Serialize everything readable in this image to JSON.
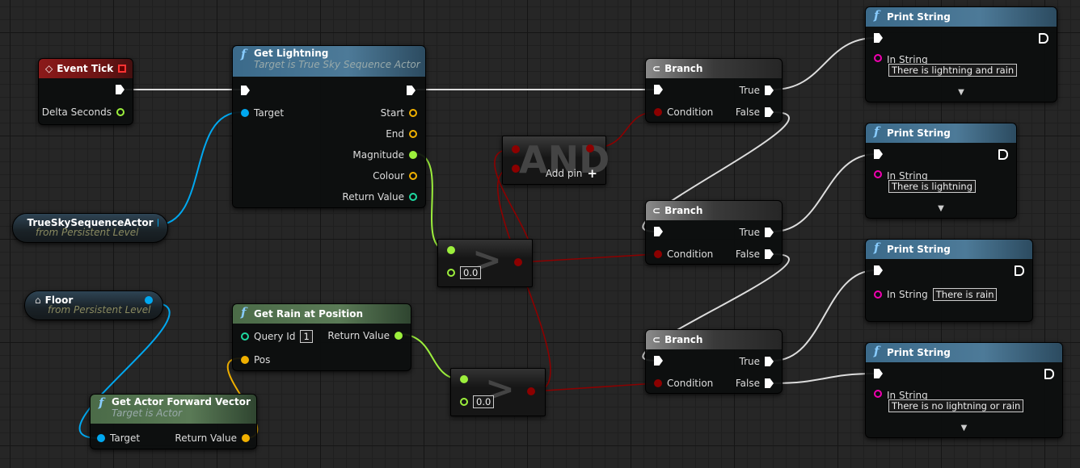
{
  "colors": {
    "exec": "#ffffff",
    "object": "#00a8f0",
    "float": "#9cef3c",
    "bool": "#8c0000",
    "struct": "#f0b000",
    "string": "#f000b0",
    "int": "#1ed9a0"
  },
  "event_tick": {
    "title": "Event Tick",
    "delta": "Delta Seconds"
  },
  "get_lightning": {
    "title": "Get Lightning",
    "subtitle": "Target is True Sky Sequence Actor",
    "target": "Target",
    "outputs": [
      "Start",
      "End",
      "Magnitude",
      "Colour",
      "Return Value"
    ]
  },
  "truesky_ref": {
    "title": "TrueSkySequenceActor",
    "subtitle": "from Persistent Level"
  },
  "floor_ref": {
    "title": "Floor",
    "subtitle": "from Persistent Level"
  },
  "get_rain": {
    "title": "Get Rain at Position",
    "query_label": "Query Id",
    "query_value": "1",
    "pos": "Pos",
    "return": "Return Value"
  },
  "forward_vector": {
    "title": "Get Actor Forward Vector",
    "subtitle": "Target is Actor",
    "target": "Target",
    "return": "Return Value"
  },
  "compare": [
    {
      "op": ">",
      "value": "0.0"
    },
    {
      "op": ">",
      "value": "0.0"
    }
  ],
  "and_node": {
    "title": "AND",
    "add_pin": "Add pin"
  },
  "branches": [
    {
      "title": "Branch",
      "condition": "Condition",
      "true": "True",
      "false": "False"
    },
    {
      "title": "Branch",
      "condition": "Condition",
      "true": "True",
      "false": "False"
    },
    {
      "title": "Branch",
      "condition": "Condition",
      "true": "True",
      "false": "False"
    }
  ],
  "print_strings": [
    {
      "title": "Print String",
      "in_label": "In String",
      "value": "There is lightning and rain"
    },
    {
      "title": "Print String",
      "in_label": "In String",
      "value": "There is lightning"
    },
    {
      "title": "Print String",
      "in_label": "In String",
      "value": "There is rain"
    },
    {
      "title": "Print String",
      "in_label": "In String",
      "value": "There is no lightning or rain"
    }
  ]
}
